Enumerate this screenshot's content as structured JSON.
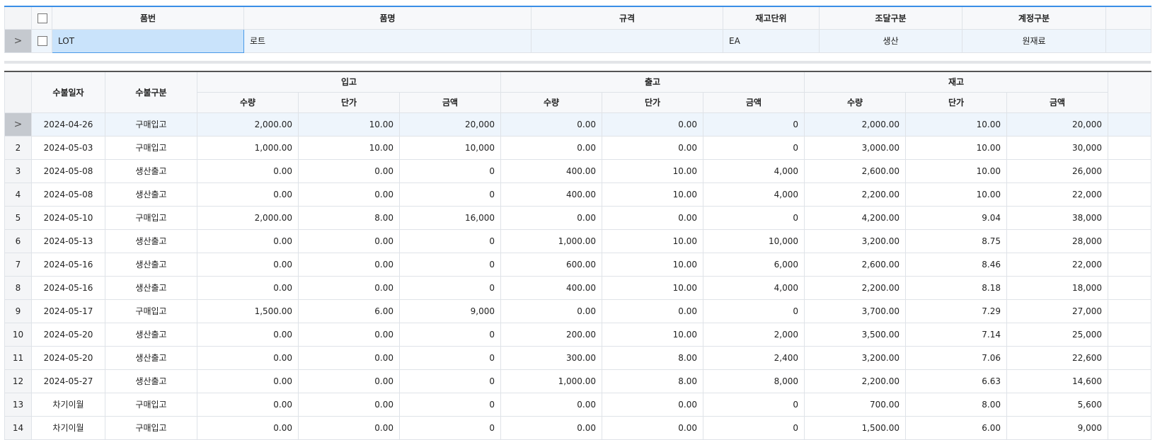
{
  "item_grid": {
    "headers": [
      "품번",
      "품명",
      "규격",
      "재고단위",
      "조달구분",
      "계정구분"
    ],
    "row": {
      "item_code": "LOT",
      "item_name": "로트",
      "spec": "",
      "stock_unit": "EA",
      "procurement": "생산",
      "account": "원재료"
    }
  },
  "ledger_grid": {
    "headers": {
      "date": "수불일자",
      "type": "수불구분",
      "receipt": "입고",
      "issue": "출고",
      "stock": "재고",
      "qty": "수량",
      "price": "단가",
      "amount": "금액"
    },
    "rows": [
      {
        "no": "1",
        "date": "2024-04-26",
        "type": "구매입고",
        "in_qty": "2,000.00",
        "in_price": "10.00",
        "in_amt": "20,000",
        "out_qty": "0.00",
        "out_price": "0.00",
        "out_amt": "0",
        "st_qty": "2,000.00",
        "st_price": "10.00",
        "st_amt": "20,000"
      },
      {
        "no": "2",
        "date": "2024-05-03",
        "type": "구매입고",
        "in_qty": "1,000.00",
        "in_price": "10.00",
        "in_amt": "10,000",
        "out_qty": "0.00",
        "out_price": "0.00",
        "out_amt": "0",
        "st_qty": "3,000.00",
        "st_price": "10.00",
        "st_amt": "30,000"
      },
      {
        "no": "3",
        "date": "2024-05-08",
        "type": "생산출고",
        "in_qty": "0.00",
        "in_price": "0.00",
        "in_amt": "0",
        "out_qty": "400.00",
        "out_price": "10.00",
        "out_amt": "4,000",
        "st_qty": "2,600.00",
        "st_price": "10.00",
        "st_amt": "26,000"
      },
      {
        "no": "4",
        "date": "2024-05-08",
        "type": "생산출고",
        "in_qty": "0.00",
        "in_price": "0.00",
        "in_amt": "0",
        "out_qty": "400.00",
        "out_price": "10.00",
        "out_amt": "4,000",
        "st_qty": "2,200.00",
        "st_price": "10.00",
        "st_amt": "22,000"
      },
      {
        "no": "5",
        "date": "2024-05-10",
        "type": "구매입고",
        "in_qty": "2,000.00",
        "in_price": "8.00",
        "in_amt": "16,000",
        "out_qty": "0.00",
        "out_price": "0.00",
        "out_amt": "0",
        "st_qty": "4,200.00",
        "st_price": "9.04",
        "st_amt": "38,000"
      },
      {
        "no": "6",
        "date": "2024-05-13",
        "type": "생산출고",
        "in_qty": "0.00",
        "in_price": "0.00",
        "in_amt": "0",
        "out_qty": "1,000.00",
        "out_price": "10.00",
        "out_amt": "10,000",
        "st_qty": "3,200.00",
        "st_price": "8.75",
        "st_amt": "28,000"
      },
      {
        "no": "7",
        "date": "2024-05-16",
        "type": "생산출고",
        "in_qty": "0.00",
        "in_price": "0.00",
        "in_amt": "0",
        "out_qty": "600.00",
        "out_price": "10.00",
        "out_amt": "6,000",
        "st_qty": "2,600.00",
        "st_price": "8.46",
        "st_amt": "22,000"
      },
      {
        "no": "8",
        "date": "2024-05-16",
        "type": "생산출고",
        "in_qty": "0.00",
        "in_price": "0.00",
        "in_amt": "0",
        "out_qty": "400.00",
        "out_price": "10.00",
        "out_amt": "4,000",
        "st_qty": "2,200.00",
        "st_price": "8.18",
        "st_amt": "18,000"
      },
      {
        "no": "9",
        "date": "2024-05-17",
        "type": "구매입고",
        "in_qty": "1,500.00",
        "in_price": "6.00",
        "in_amt": "9,000",
        "out_qty": "0.00",
        "out_price": "0.00",
        "out_amt": "0",
        "st_qty": "3,700.00",
        "st_price": "7.29",
        "st_amt": "27,000"
      },
      {
        "no": "10",
        "date": "2024-05-20",
        "type": "생산출고",
        "in_qty": "0.00",
        "in_price": "0.00",
        "in_amt": "0",
        "out_qty": "200.00",
        "out_price": "10.00",
        "out_amt": "2,000",
        "st_qty": "3,500.00",
        "st_price": "7.14",
        "st_amt": "25,000"
      },
      {
        "no": "11",
        "date": "2024-05-20",
        "type": "생산출고",
        "in_qty": "0.00",
        "in_price": "0.00",
        "in_amt": "0",
        "out_qty": "300.00",
        "out_price": "8.00",
        "out_amt": "2,400",
        "st_qty": "3,200.00",
        "st_price": "7.06",
        "st_amt": "22,600"
      },
      {
        "no": "12",
        "date": "2024-05-27",
        "type": "생산출고",
        "in_qty": "0.00",
        "in_price": "0.00",
        "in_amt": "0",
        "out_qty": "1,000.00",
        "out_price": "8.00",
        "out_amt": "8,000",
        "st_qty": "2,200.00",
        "st_price": "6.63",
        "st_amt": "14,600"
      },
      {
        "no": "13",
        "date": "차기이월",
        "type": "구매입고",
        "in_qty": "0.00",
        "in_price": "0.00",
        "in_amt": "0",
        "out_qty": "0.00",
        "out_price": "0.00",
        "out_amt": "0",
        "st_qty": "700.00",
        "st_price": "8.00",
        "st_amt": "5,600"
      },
      {
        "no": "14",
        "date": "차기이월",
        "type": "구매입고",
        "in_qty": "0.00",
        "in_price": "0.00",
        "in_amt": "0",
        "out_qty": "0.00",
        "out_price": "0.00",
        "out_amt": "0",
        "st_qty": "1,500.00",
        "st_price": "6.00",
        "st_amt": "9,000"
      }
    ]
  }
}
